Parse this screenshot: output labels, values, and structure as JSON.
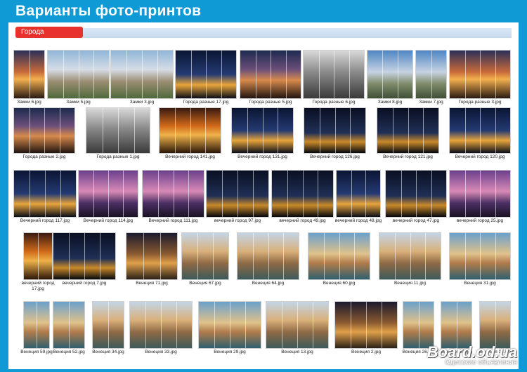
{
  "header": {
    "title": "Варианты фото-принтов"
  },
  "section": {
    "label": "Города"
  },
  "watermark": {
    "brand": "Board.od.ua",
    "tagline": "Одесские объявления"
  },
  "tiles": [
    {
      "caption": "Замки 6.jpg",
      "theme": "c-sunset"
    },
    {
      "caption": "Замки 5.jpg",
      "theme": "c-castle"
    },
    {
      "caption": "Замки 3.jpg",
      "theme": "c-castle"
    },
    {
      "caption": "Города разные 17.jpg",
      "theme": "c-night"
    },
    {
      "caption": "Города разные 5.jpg",
      "theme": "c-dusk"
    },
    {
      "caption": "Города разные 6.jpg",
      "theme": "c-bw"
    },
    {
      "caption": "Замки 8.jpg",
      "theme": "c-castle2"
    },
    {
      "caption": "Замки 7.jpg",
      "theme": "c-castle2"
    },
    {
      "caption": "Города разные 3.jpg",
      "theme": "c-sunset"
    },
    {
      "caption": "Города разные 2.jpg",
      "theme": "c-dusk"
    },
    {
      "caption": "Города разные 1.jpg",
      "theme": "c-bw"
    },
    {
      "caption": "Вечерний город 141.jpg",
      "theme": "c-orange"
    },
    {
      "caption": "Вечерний город 131.jpg",
      "theme": "c-night"
    },
    {
      "caption": "Вечерний город 126.jpg",
      "theme": "c-night2"
    },
    {
      "caption": "Вечерний город 121.jpg",
      "theme": "c-night2"
    },
    {
      "caption": "Вечерний город 120.jpg",
      "theme": "c-night"
    },
    {
      "caption": "Вечерний город 117.jpg",
      "theme": "c-night"
    },
    {
      "caption": "Вечерний город 114.jpg",
      "theme": "c-pink"
    },
    {
      "caption": "Вечерний город 111.jpg",
      "theme": "c-pink"
    },
    {
      "caption": "вечерний город 97.jpg",
      "theme": "c-night2"
    },
    {
      "caption": "вечерний город 49.jpg",
      "theme": "c-night2"
    },
    {
      "caption": "вечерний город 48.jpg",
      "theme": "c-night"
    },
    {
      "caption": "вечерний город 47.jpg",
      "theme": "c-night2"
    },
    {
      "caption": "вечерний город 25.jpg",
      "theme": "c-pink"
    },
    {
      "caption": "вечерний город 17.jpg",
      "theme": "c-orange",
      "wrap": true
    },
    {
      "caption": "вечерний город 7.jpg",
      "theme": "c-night2"
    },
    {
      "caption": "Венеция 71.jpg",
      "theme": "c-venice3"
    },
    {
      "caption": "Венеция 67.jpg",
      "theme": "c-venice"
    },
    {
      "caption": "Венеция 64.jpg",
      "theme": "c-venice"
    },
    {
      "caption": "Венеция 60.jpg",
      "theme": "c-venice2"
    },
    {
      "caption": "Венеция 11.jpg",
      "theme": "c-venice"
    },
    {
      "caption": "Венеция 31.jpg",
      "theme": "c-venice2"
    },
    {
      "caption": "Венеция 59.jpg",
      "theme": "c-venice2"
    },
    {
      "caption": "Венеция 52.jpg",
      "theme": "c-venice2"
    },
    {
      "caption": "Венеция 34.jpg",
      "theme": "c-venice"
    },
    {
      "caption": "Венеция 33.jpg",
      "theme": "c-venice"
    },
    {
      "caption": "Венеция 29.jpg",
      "theme": "c-venice2"
    },
    {
      "caption": "Венеция 13.jpg",
      "theme": "c-venice"
    },
    {
      "caption": "Венеция 2.jpg",
      "theme": "c-venice3"
    },
    {
      "caption": "Венеция 26.jpg",
      "theme": "c-venice2"
    },
    {
      "caption": "Венеция 23.jpg",
      "theme": "c-venice2"
    },
    {
      "caption": "Венеция 12.jpg",
      "theme": "c-venice"
    }
  ]
}
